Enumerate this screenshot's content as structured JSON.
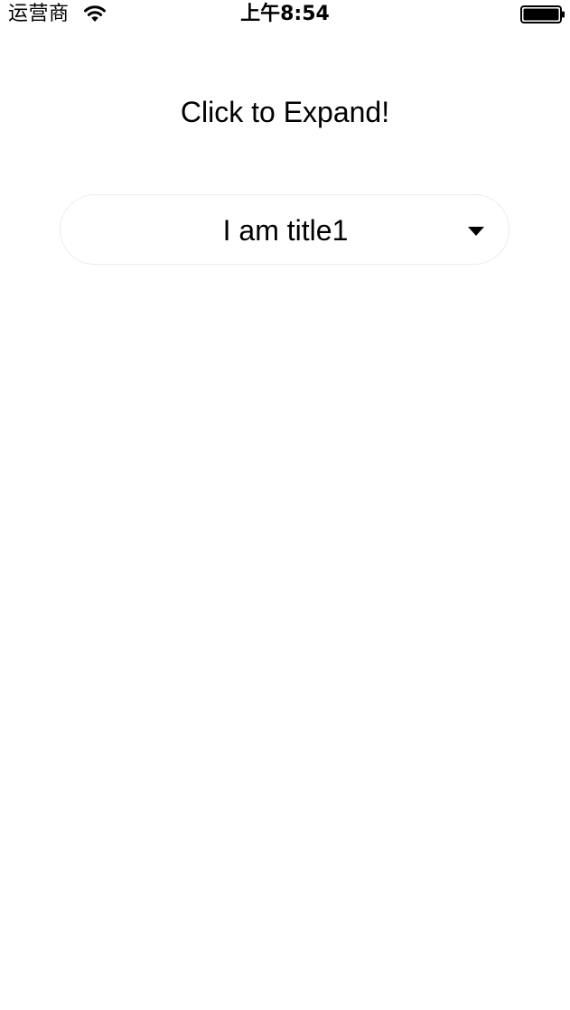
{
  "status_bar": {
    "carrier": "运营商",
    "time": "上午8:54",
    "wifi_icon": "wifi-icon",
    "battery_icon": "battery-full-icon"
  },
  "main": {
    "title": "Click to Expand!",
    "dropdown": {
      "selected_label": "I am title1",
      "arrow_icon": "caret-down-icon"
    }
  }
}
